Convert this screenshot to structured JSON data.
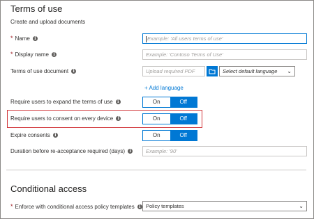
{
  "section1": {
    "title": "Terms of use",
    "subtitle": "Create and upload documents"
  },
  "fields": {
    "name": {
      "label": "Name",
      "placeholder": "Example: 'All users terms of use'"
    },
    "display_name": {
      "label": "Display name",
      "placeholder": "Example: 'Contoso Terms of Use'"
    },
    "terms_doc": {
      "label": "Terms of use document",
      "placeholder": "Upload required PDF",
      "language": "Select default language"
    },
    "add_language": "+ Add language",
    "expand": {
      "label": "Require users to expand the terms of use",
      "on": "On",
      "off": "Off"
    },
    "consent": {
      "label": "Require users to consent on every device",
      "on": "On",
      "off": "Off"
    },
    "expire": {
      "label": "Expire consents",
      "on": "On",
      "off": "Off"
    },
    "duration": {
      "label": "Duration before re-acceptance required (days)",
      "placeholder": "Example: '90'"
    }
  },
  "section2": {
    "title": "Conditional access",
    "enforce_label": "Enforce with conditional access policy templates",
    "enforce_value": "Policy templates"
  },
  "colors": {
    "accent": "#0078d4",
    "highlight": "#d13438",
    "required": "#a4262c"
  }
}
